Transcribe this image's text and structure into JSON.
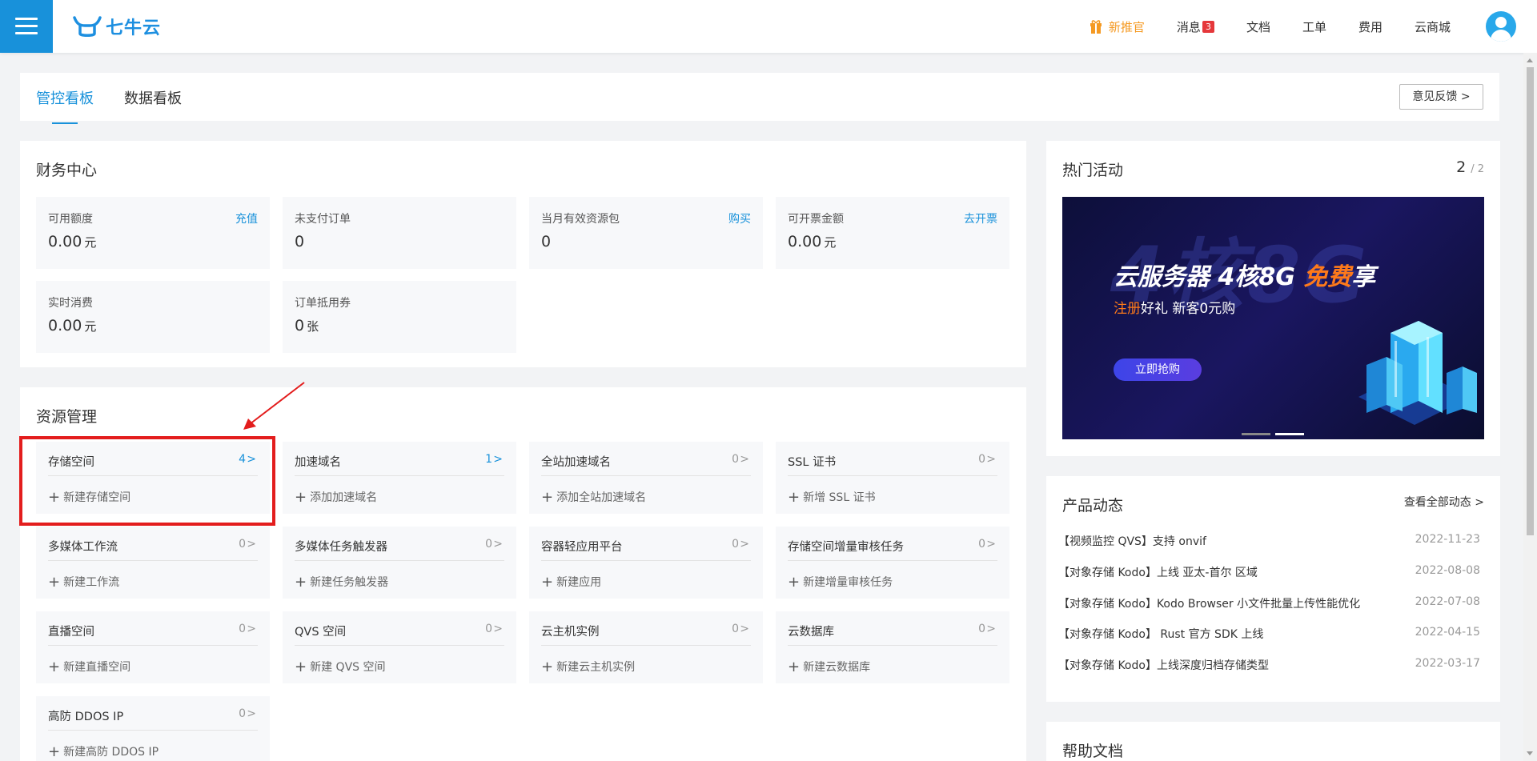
{
  "header": {
    "logo_text": "七牛云",
    "promo_label": "新推官",
    "nav": {
      "messages": "消息",
      "messages_count": "3",
      "docs": "文档",
      "tickets": "工单",
      "billing": "费用",
      "store": "云商城"
    }
  },
  "tabs": {
    "control": "管控看板",
    "data": "数据看板",
    "feedback": "意见反馈 >"
  },
  "finance": {
    "title": "财务中心",
    "cards": [
      {
        "label": "可用额度",
        "link": "充值",
        "value": "0.00",
        "unit": "元"
      },
      {
        "label": "未支付订单",
        "link": "",
        "value": "0",
        "unit": ""
      },
      {
        "label": "当月有效资源包",
        "link": "购买",
        "value": "0",
        "unit": ""
      },
      {
        "label": "可开票金额",
        "link": "去开票",
        "value": "0.00",
        "unit": "元"
      },
      {
        "label": "实时消费",
        "link": "",
        "value": "0.00",
        "unit": "元"
      },
      {
        "label": "订单抵用券",
        "link": "",
        "value": "0",
        "unit": "张"
      }
    ]
  },
  "resources": {
    "title": "资源管理",
    "cards": [
      {
        "label": "存储空间",
        "count": "4",
        "action": "新建存储空间"
      },
      {
        "label": "加速域名",
        "count": "1",
        "action": "添加加速域名"
      },
      {
        "label": "全站加速域名",
        "count": "0",
        "action": "添加全站加速域名"
      },
      {
        "label": "SSL 证书",
        "count": "0",
        "action": "新增 SSL 证书"
      },
      {
        "label": "多媒体工作流",
        "count": "0",
        "action": "新建工作流"
      },
      {
        "label": "多媒体任务触发器",
        "count": "0",
        "action": "新建任务触发器"
      },
      {
        "label": "容器轻应用平台",
        "count": "0",
        "action": "新建应用"
      },
      {
        "label": "存储空间增量审核任务",
        "count": "0",
        "action": "新建增量审核任务"
      },
      {
        "label": "直播空间",
        "count": "0",
        "action": "新建直播空间"
      },
      {
        "label": "QVS 空间",
        "count": "0",
        "action": "新建 QVS 空间"
      },
      {
        "label": "云主机实例",
        "count": "0",
        "action": "新建云主机实例"
      },
      {
        "label": "云数据库",
        "count": "0",
        "action": "新建云数据库"
      },
      {
        "label": "高防 DDOS IP",
        "count": "0",
        "action": "新建高防 DDOS IP"
      }
    ]
  },
  "activities": {
    "title": "热门活动",
    "page": "2",
    "total": "/ 2",
    "banner": {
      "bg_text": "4核8G",
      "title_main": "云服务器 4核8G ",
      "title_hl": "免费",
      "title_end": "享",
      "sub_hl": "注册",
      "sub_rest": "好礼  新客0元购",
      "button": "立即抢购"
    }
  },
  "news": {
    "title": "产品动态",
    "more": "查看全部动态 >",
    "items": [
      {
        "text": "【视频监控 QVS】支持 onvif",
        "date": "2022-11-23"
      },
      {
        "text": "【对象存储 Kodo】上线 亚太-首尔 区域",
        "date": "2022-08-08"
      },
      {
        "text": "【对象存储 Kodo】Kodo Browser 小文件批量上传性能优化",
        "date": "2022-07-08"
      },
      {
        "text": "【对象存储 Kodo】 Rust 官方 SDK 上线",
        "date": "2022-04-15"
      },
      {
        "text": "【对象存储 Kodo】上线深度归档存储类型",
        "date": "2022-03-17"
      }
    ]
  },
  "help": {
    "title": "帮助文档"
  },
  "colors": {
    "accent": "#1891da",
    "promo": "#f59a23",
    "highlight": "#e31d1d"
  }
}
